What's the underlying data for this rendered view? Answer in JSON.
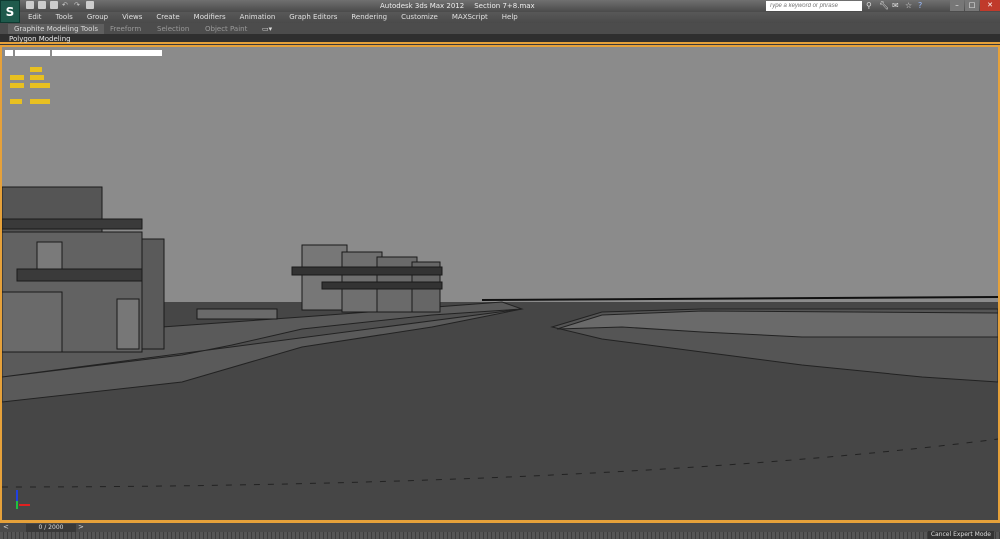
{
  "app": {
    "title": "Autodesk 3ds Max  2012",
    "file": "Section 7+8.max"
  },
  "search": {
    "placeholder": "Type a keyword or phrase"
  },
  "menu": [
    "Edit",
    "Tools",
    "Group",
    "Views",
    "Create",
    "Modifiers",
    "Animation",
    "Graph Editors",
    "Rendering",
    "Customize",
    "MAXScript",
    "Help"
  ],
  "ribbon": {
    "tabs": [
      "Graphite Modeling Tools",
      "Freeform",
      "Selection",
      "Object Paint"
    ],
    "panel": "Polygon Modeling"
  },
  "timeline": {
    "slider": "0 / 2000",
    "prev": "<",
    "next": ">"
  },
  "status": {
    "cancel_expert": "Cancel Expert Mode"
  },
  "colors": {
    "accent": "#e6a13a",
    "sky": "#8b8b8b",
    "ground": "#464646"
  }
}
